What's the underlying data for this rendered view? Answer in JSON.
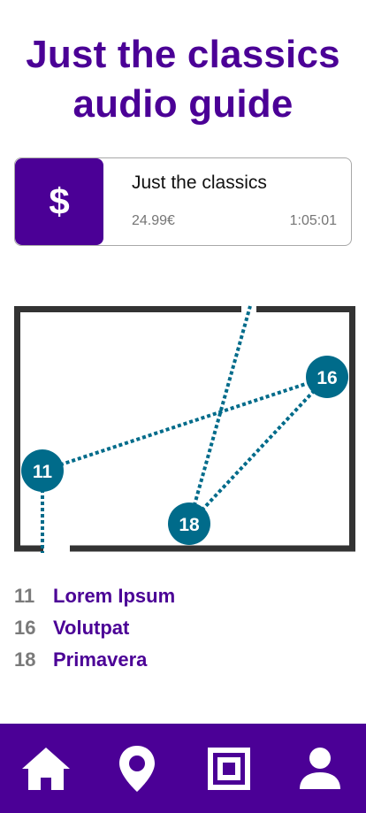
{
  "header": {
    "title": "Just the classics audio guide"
  },
  "tour_card": {
    "icon": "dollar-icon",
    "icon_text": "$",
    "title": "Just the classics",
    "price": "24.99€",
    "duration": "1:05:01"
  },
  "map": {
    "stops": [
      {
        "number": "11"
      },
      {
        "number": "16"
      },
      {
        "number": "18"
      }
    ],
    "colors": {
      "route": "#006b8a",
      "walls": "#333333"
    }
  },
  "stop_list": [
    {
      "number": "11",
      "name": "Lorem Ipsum"
    },
    {
      "number": "16",
      "name": "Volutpat"
    },
    {
      "number": "18",
      "name": "Primavera"
    }
  ],
  "bottom_nav": {
    "items": [
      {
        "icon": "home-icon"
      },
      {
        "icon": "location-pin-icon"
      },
      {
        "icon": "qr-code-icon"
      },
      {
        "icon": "profile-icon"
      }
    ]
  },
  "colors": {
    "accent": "#4b0096",
    "muted": "#757575"
  }
}
